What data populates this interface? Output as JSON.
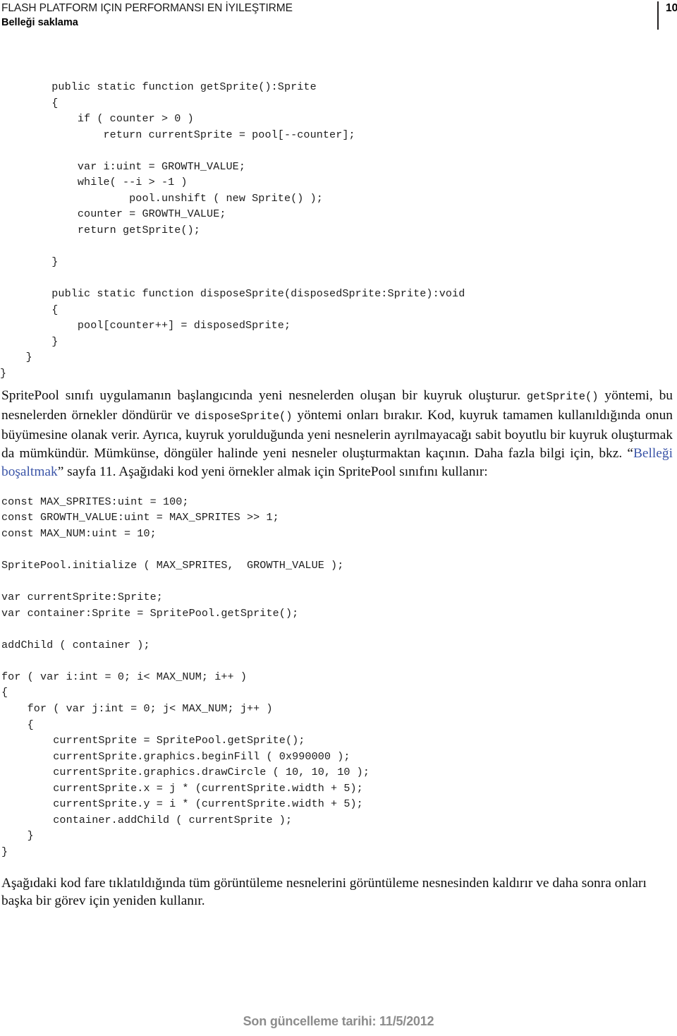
{
  "header": {
    "title": "FLASH PLATFORM IÇIN PERFORMANSI EN İYILEŞTIRME",
    "subtitle": "Belleği saklama",
    "page_number": "10"
  },
  "code_block_1": "        public static function getSprite():Sprite\n        {\n            if ( counter > 0 )\n                return currentSprite = pool[--counter];\n\n            var i:uint = GROWTH_VALUE;\n            while( --i > -1 )\n                    pool.unshift ( new Sprite() );\n            counter = GROWTH_VALUE;\n            return getSprite();\n\n        }\n\n        public static function disposeSprite(disposedSprite:Sprite):void\n        {\n            pool[counter++] = disposedSprite;\n        }\n    }\n}",
  "paragraph_1": {
    "part_1": "SpritePool sınıfı uygulamanın başlangıcında yeni nesnelerden oluşan bir kuyruk oluşturur. ",
    "code_1": "getSprite()",
    "part_2": " yöntemi, bu nesnelerden örnekler döndürür ve ",
    "code_2": "disposeSprite()",
    "part_3": " yöntemi onları bırakır. Kod, kuyruk tamamen kullanıldığında onun büyümesine olanak verir. Ayrıca, kuyruk yorulduğunda yeni nesnelerin ayrılmayacağı sabit boyutlu bir kuyruk oluşturmak da mümkündür. Mümkünse, döngüler halinde yeni nesneler oluşturmaktan kaçının. Daha fazla bilgi için, bkz. “",
    "link_text": "Belleği boşaltmak",
    "part_4": "” sayfa 11. Aşağıdaki kod yeni örnekler almak için SpritePool sınıfını kullanır:"
  },
  "code_block_2": "const MAX_SPRITES:uint = 100;\nconst GROWTH_VALUE:uint = MAX_SPRITES >> 1;\nconst MAX_NUM:uint = 10;\n\nSpritePool.initialize ( MAX_SPRITES,  GROWTH_VALUE );\n\nvar currentSprite:Sprite;\nvar container:Sprite = SpritePool.getSprite();\n\naddChild ( container );\n\nfor ( var i:int = 0; i< MAX_NUM; i++ )\n{\n    for ( var j:int = 0; j< MAX_NUM; j++ )\n    {\n        currentSprite = SpritePool.getSprite();\n        currentSprite.graphics.beginFill ( 0x990000 );\n        currentSprite.graphics.drawCircle ( 10, 10, 10 );\n        currentSprite.x = j * (currentSprite.width + 5);\n        currentSprite.y = i * (currentSprite.width + 5);\n        container.addChild ( currentSprite );\n    }\n}",
  "paragraph_2": {
    "text": "Aşağıdaki kod fare tıklatıldığında tüm görüntüleme nesnelerini görüntüleme nesnesinden kaldırır ve daha sonra onları başka bir görev için yeniden kullanır."
  },
  "footer": {
    "text": "Son güncelleme tarihi: 11/5/2012"
  },
  "colors": {
    "link": "#3b55a8",
    "footer_text": "#8c8c8c",
    "body_text": "#101010",
    "rule": "#231f20"
  }
}
